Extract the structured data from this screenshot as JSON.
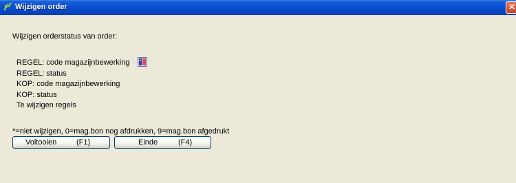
{
  "window": {
    "title": "Wijzigen order",
    "icon": "app-icon",
    "close_label": "✕"
  },
  "dialog": {
    "heading": "Wijzigen orderstatus van order:",
    "lines": [
      "REGEL: code magazijnbewerking",
      "REGEL: status",
      "KOP: code magazijnbewerking",
      "KOP: status",
      "Te wijzigen regels"
    ],
    "line_icon": "info-icon",
    "note": "*=niet wijzigen, 0=mag.bon nog afdrukken, 9=mag.bon afgedrukt"
  },
  "buttons": {
    "voltooien_label": "Voltooien",
    "voltooien_key": "(F1)",
    "einde_label": "Einde",
    "einde_key": "(F4)"
  },
  "colors": {
    "titlebar": "#0a52d4",
    "background": "#ece9d8",
    "close": "#c9422a"
  }
}
